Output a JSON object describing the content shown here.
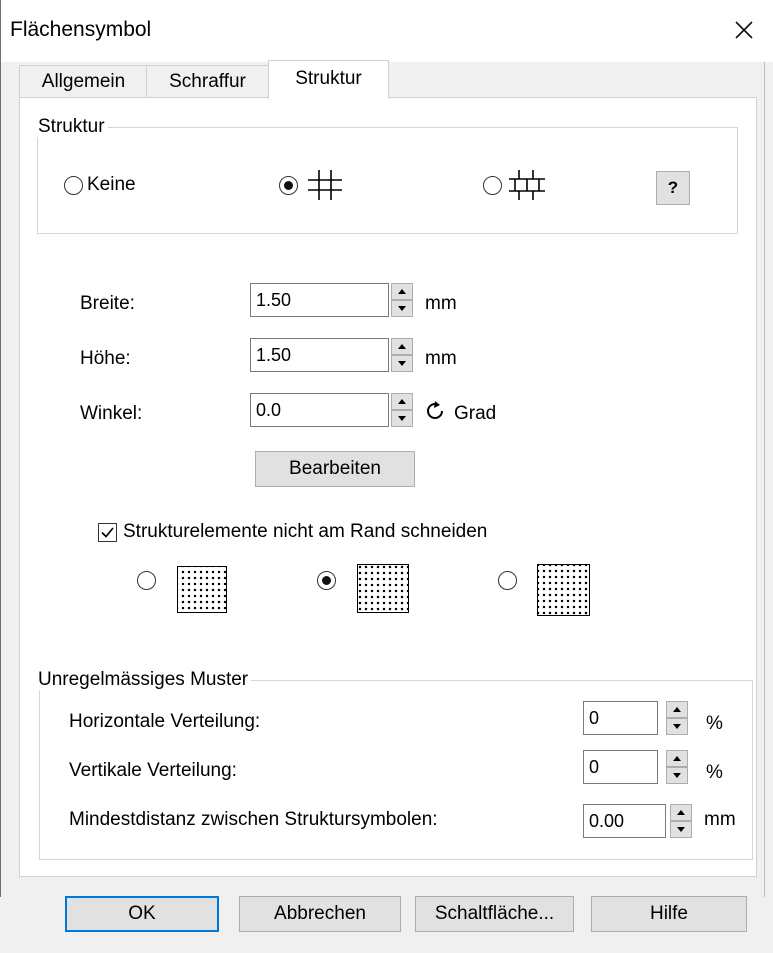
{
  "window": {
    "title": "Flächensymbol",
    "close_icon": "close-icon"
  },
  "tabs": [
    {
      "label": "Allgemein",
      "active": false
    },
    {
      "label": "Schraffur",
      "active": false
    },
    {
      "label": "Struktur",
      "active": true
    }
  ],
  "structure_group": {
    "label": "Struktur",
    "options": [
      {
        "label": "Keine",
        "selected": false,
        "icon": "none"
      },
      {
        "label": "",
        "selected": true,
        "icon": "grid-pattern-icon"
      },
      {
        "label": "",
        "selected": false,
        "icon": "grid-offset-pattern-icon"
      }
    ],
    "help_label": "?"
  },
  "dimensions": {
    "width": {
      "label": "Breite:",
      "value": "1.50",
      "unit": "mm"
    },
    "height": {
      "label": "Höhe:",
      "value": "1.50",
      "unit": "mm"
    },
    "angle": {
      "label": "Winkel:",
      "value": "0.0",
      "unit": "Grad",
      "icon": "rotate-icon"
    },
    "edit_button": "Bearbeiten"
  },
  "clip": {
    "checkbox_label": "Strukturelemente nicht am Rand schneiden",
    "checked": true,
    "patterns": [
      {
        "selected": false,
        "icon": "pattern-inside-icon"
      },
      {
        "selected": true,
        "icon": "pattern-edge-icon"
      },
      {
        "selected": false,
        "icon": "pattern-overflow-icon"
      }
    ]
  },
  "irregular": {
    "label": "Unregelmässiges Muster",
    "horizontal": {
      "label": "Horizontale Verteilung:",
      "value": "0",
      "unit": "%"
    },
    "vertical": {
      "label": "Vertikale Verteilung:",
      "value": "0",
      "unit": "%"
    },
    "min_distance": {
      "label": "Mindestdistanz zwischen Struktursymbolen:",
      "value": "0.00",
      "unit": "mm"
    }
  },
  "buttons": {
    "ok": "OK",
    "cancel": "Abbrechen",
    "button": "Schaltfläche...",
    "help": "Hilfe"
  }
}
